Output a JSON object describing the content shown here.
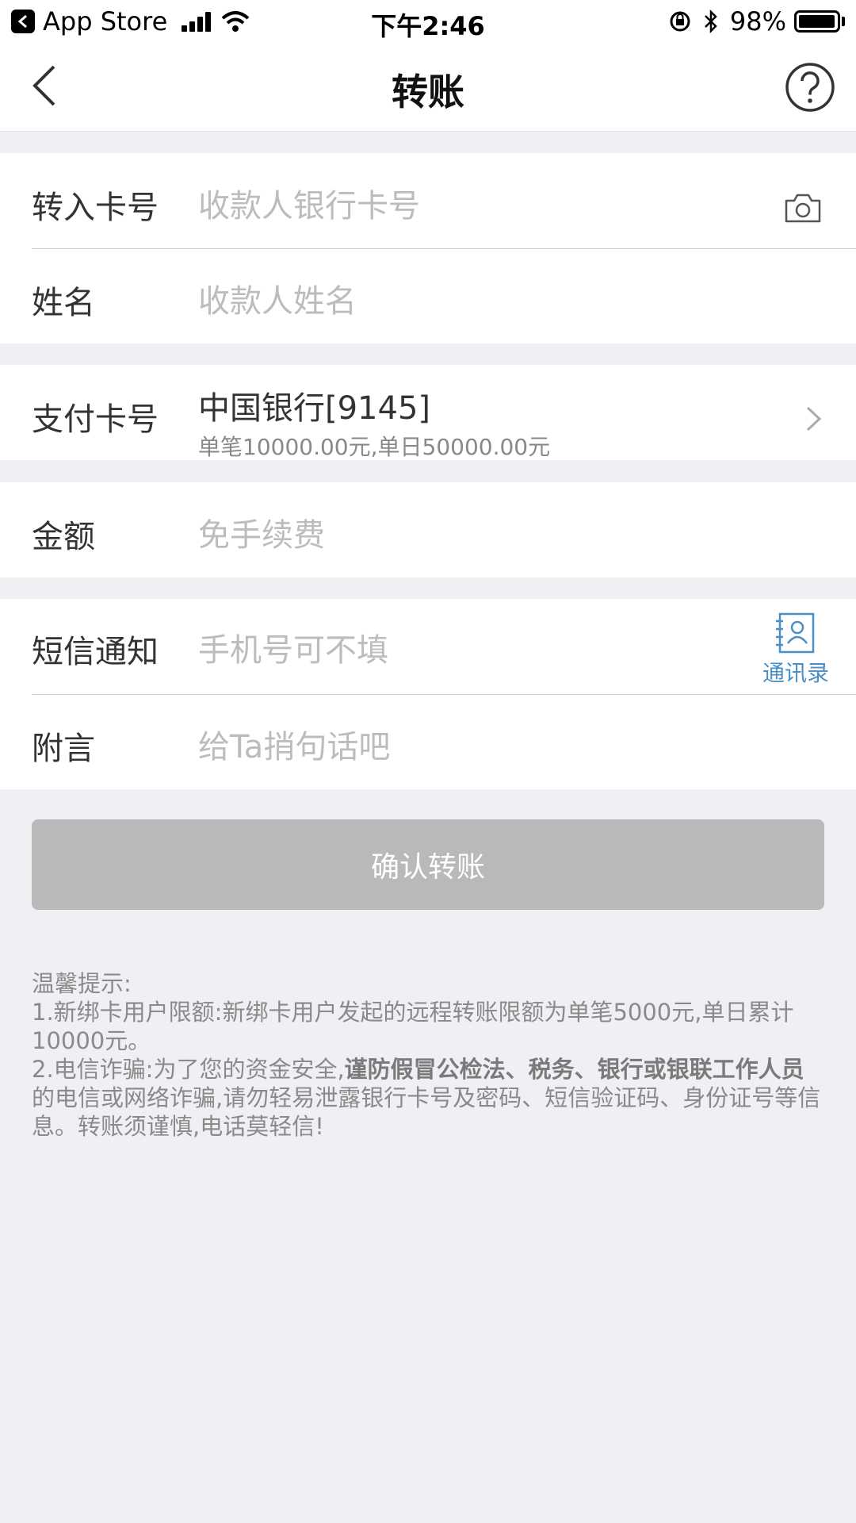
{
  "status_bar": {
    "back_app": "App Store",
    "time": "下午2:46",
    "battery": "98%",
    "battery_level": 0.98
  },
  "nav": {
    "title": "转账"
  },
  "form": {
    "card_number": {
      "label": "转入卡号",
      "placeholder": "收款人银行卡号"
    },
    "name": {
      "label": "姓名",
      "placeholder": "收款人姓名"
    },
    "pay_card": {
      "label": "支付卡号",
      "value": "中国银行[9145]",
      "limit": "单笔10000.00元,单日50000.00元"
    },
    "amount": {
      "label": "金额",
      "placeholder": "免手续费"
    },
    "sms": {
      "label": "短信通知",
      "placeholder": "手机号可不填",
      "contacts_label": "通讯录"
    },
    "note": {
      "label": "附言",
      "placeholder": "给Ta捎句话吧"
    }
  },
  "confirm_button": "确认转账",
  "tips": {
    "title": "温馨提示:",
    "line1": "1.新绑卡用户限额:新绑卡用户发起的远程转账限额为单笔5000元,单日累计10000元。",
    "line2_prefix": "2.电信诈骗:为了您的资金安全,",
    "line2_bold": "谨防假冒公检法、税务、银行或银联工作人员",
    "line2_suffix": "的电信或网络诈骗,请勿轻易泄露银行卡号及密码、短信验证码、身份证号等信息。转账须谨慎,电话莫轻信!"
  },
  "colors": {
    "accent_blue": "#4a90c8",
    "disabled_button": "#b9b9b9",
    "placeholder": "#bcbcbc",
    "background": "#efeff4"
  }
}
